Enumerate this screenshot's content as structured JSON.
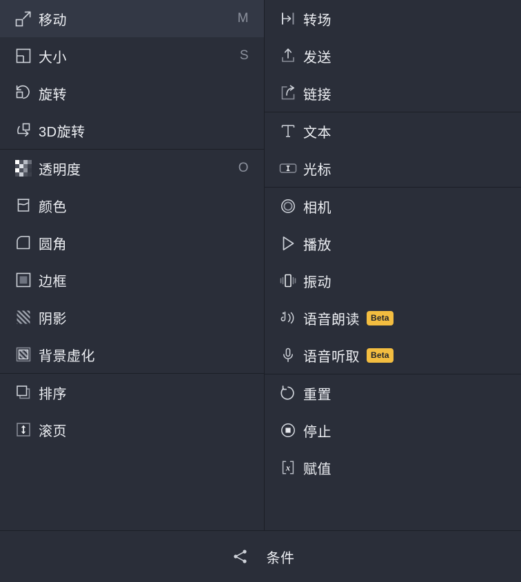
{
  "theme": {
    "background": "#2a2e39",
    "divider": "#1b1e26",
    "label_color": "#edeff3",
    "icon_color": "#cfd3da",
    "shortcut_color": "#8d929e",
    "badge_background": "#f3bd40",
    "badge_text_color": "#22242b"
  },
  "left_column": {
    "groups": [
      {
        "items": [
          {
            "label": "移动",
            "shortcut": "M",
            "icon": "move-arrow-icon"
          },
          {
            "label": "大小",
            "shortcut": "S",
            "icon": "resize-icon"
          },
          {
            "label": "旋转",
            "shortcut": "",
            "icon": "rotate-icon"
          },
          {
            "label": "3D旋转",
            "shortcut": "",
            "icon": "rotate-3d-icon"
          }
        ]
      },
      {
        "items": [
          {
            "label": "透明度",
            "shortcut": "O",
            "icon": "opacity-checker-icon"
          },
          {
            "label": "颜色",
            "shortcut": "",
            "icon": "color-fill-icon"
          },
          {
            "label": "圆角",
            "shortcut": "",
            "icon": "corner-radius-icon"
          },
          {
            "label": "边框",
            "shortcut": "",
            "icon": "border-icon"
          },
          {
            "label": "阴影",
            "shortcut": "",
            "icon": "shadow-icon"
          },
          {
            "label": "背景虚化",
            "shortcut": "",
            "icon": "background-blur-icon"
          }
        ]
      },
      {
        "items": [
          {
            "label": "排序",
            "shortcut": "",
            "icon": "layer-order-icon"
          },
          {
            "label": "滚页",
            "shortcut": "",
            "icon": "scroll-page-icon"
          }
        ]
      }
    ]
  },
  "right_column": {
    "groups": [
      {
        "items": [
          {
            "label": "转场",
            "shortcut": "",
            "icon": "transition-icon",
            "badge": ""
          },
          {
            "label": "发送",
            "shortcut": "",
            "icon": "send-upload-icon",
            "badge": ""
          },
          {
            "label": "链接",
            "shortcut": "",
            "icon": "external-link-icon",
            "badge": ""
          }
        ]
      },
      {
        "items": [
          {
            "label": "文本",
            "shortcut": "",
            "icon": "text-t-icon",
            "badge": ""
          },
          {
            "label": "光标",
            "shortcut": "",
            "icon": "cursor-field-icon",
            "badge": ""
          }
        ]
      },
      {
        "items": [
          {
            "label": "相机",
            "shortcut": "",
            "icon": "camera-icon",
            "badge": ""
          },
          {
            "label": "播放",
            "shortcut": "",
            "icon": "play-icon",
            "badge": ""
          },
          {
            "label": "振动",
            "shortcut": "",
            "icon": "vibrate-icon",
            "badge": ""
          },
          {
            "label": "语音朗读",
            "shortcut": "",
            "icon": "speech-read-icon",
            "badge": "Beta"
          },
          {
            "label": "语音听取",
            "shortcut": "",
            "icon": "microphone-icon",
            "badge": "Beta"
          }
        ]
      },
      {
        "items": [
          {
            "label": "重置",
            "shortcut": "",
            "icon": "reset-undo-icon",
            "badge": ""
          },
          {
            "label": "停止",
            "shortcut": "",
            "icon": "stop-icon",
            "badge": ""
          },
          {
            "label": "赋值",
            "shortcut": "",
            "icon": "assign-x-icon",
            "badge": ""
          }
        ]
      }
    ]
  },
  "footer": {
    "label": "条件",
    "icon": "share-branch-icon"
  }
}
